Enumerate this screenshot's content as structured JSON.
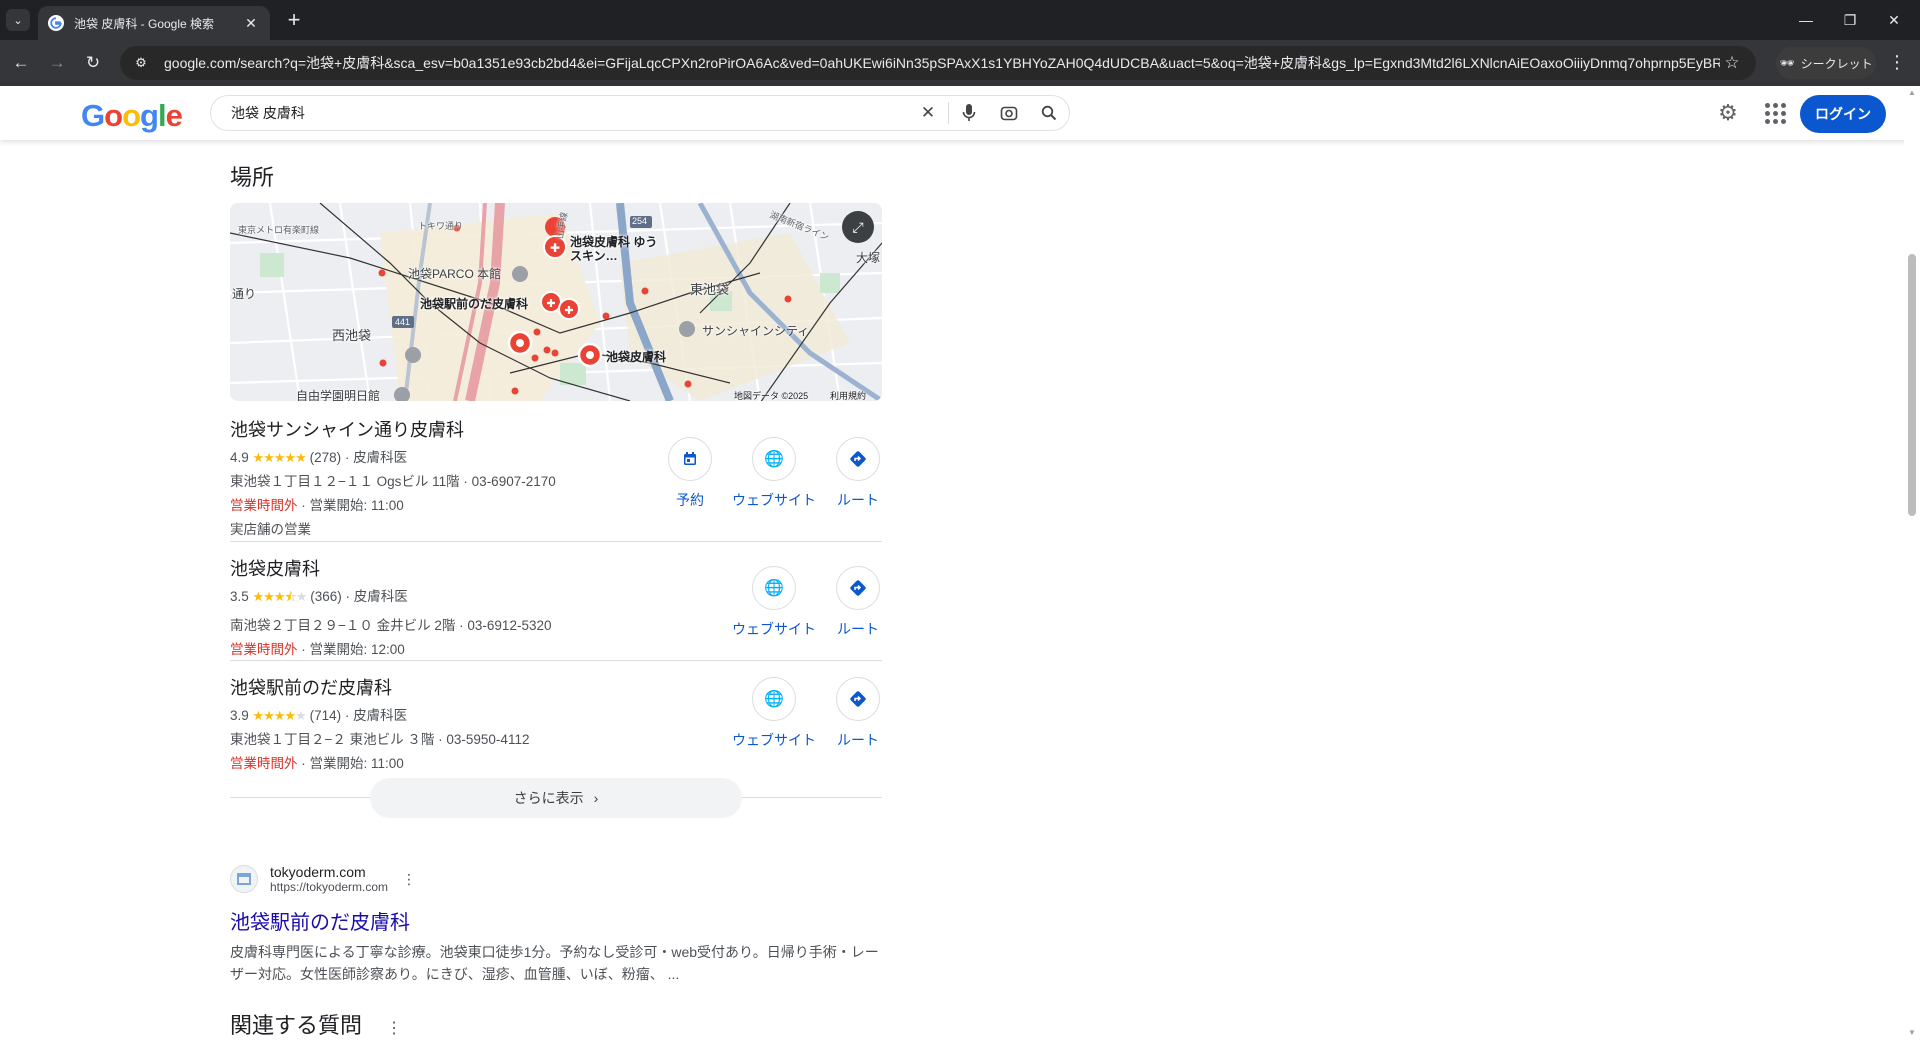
{
  "browser": {
    "tab_title": "池袋 皮膚科 - Google 検索",
    "url": "google.com/search?q=池袋+皮膚科&sca_esv=b0a1351e93cb2bd4&ei=GFijaLqcCPXn2roPirOA6Ac&ved=0ahUKEwi6iNn35pSPAxX1s1YBHYoZAH0Q4dUDCBA&uact=5&oq=池袋+皮膚科&gs_lp=Egxnd3Mtd2l6LXNlcnAiEOaxoOiiiyDnmq7ohprnp5EyBRAA...",
    "incognito_label": "シークレット"
  },
  "search": {
    "query": "池袋 皮膚科",
    "login_label": "ログイン"
  },
  "places": {
    "title": "場所",
    "map_labels": {
      "line_top_left": "東京メトロ有楽町線",
      "toshima": "トキワ通り",
      "parco": "池袋PARCO 本館",
      "yamanote": "山手線",
      "route254": "254",
      "shonan": "湖南新宿ライン",
      "otsuka": "大塚",
      "pin1": "池袋皮膚科 ゆうスキン…",
      "pin2": "池袋駅前のだ皮膚科",
      "higashi": "東池袋",
      "sunshine": "サンシャインシティ",
      "route441": "441",
      "nishi": "西池袋",
      "pin3": "池袋皮膚科",
      "jiyu": "自由学園明日館",
      "left_edge": "通り",
      "copyright": "地図データ ©2025",
      "terms": "利用規約"
    },
    "items": [
      {
        "name": "池袋サンシャイン通り皮膚科",
        "rating": "4.9",
        "stars": 5,
        "reviews": "(278)",
        "category": "皮膚科医",
        "address": "東池袋１丁目１２−１１ Ogsビル 11階",
        "phone": "03-6907-2170",
        "status": "営業時間外",
        "opens": "営業開始: 11:00",
        "extra": "実店舗の営業",
        "actions": [
          "予約",
          "ウェブサイト",
          "ルート"
        ]
      },
      {
        "name": "池袋皮膚科",
        "rating": "3.5",
        "stars": 3.5,
        "reviews": "(366)",
        "category": "皮膚科医",
        "address": "南池袋２丁目２９−１０ 金井ビル 2階",
        "phone": "03-6912-5320",
        "status": "営業時間外",
        "opens": "営業開始: 12:00",
        "actions": [
          "ウェブサイト",
          "ルート"
        ]
      },
      {
        "name": "池袋駅前のだ皮膚科",
        "rating": "3.9",
        "stars": 4,
        "reviews": "(714)",
        "category": "皮膚科医",
        "address": "東池袋１丁目２−２ 東池ビル ３階",
        "phone": "03-5950-4112",
        "status": "営業時間外",
        "opens": "営業開始: 11:00",
        "actions": [
          "ウェブサイト",
          "ルート"
        ]
      }
    ],
    "more_label": "さらに表示"
  },
  "result": {
    "site_name": "tokyoderm.com",
    "site_url": "https://tokyoderm.com",
    "title": "池袋駅前のだ皮膚科",
    "snippet": "皮膚科専門医による丁寧な診療。池袋東口徒歩1分。予約なし受診可・web受付あり。日帰り手術・レーザー対応。女性医師診察あり。にきび、湿疹、血管腫、いぼ、粉瘤、 ..."
  },
  "related": {
    "title": "関連する質問"
  },
  "colors": {
    "accent": "#0b57d0",
    "link": "#1a0dab",
    "closed": "#d93025",
    "star": "#fbbc04",
    "pin": "#ea4335"
  }
}
